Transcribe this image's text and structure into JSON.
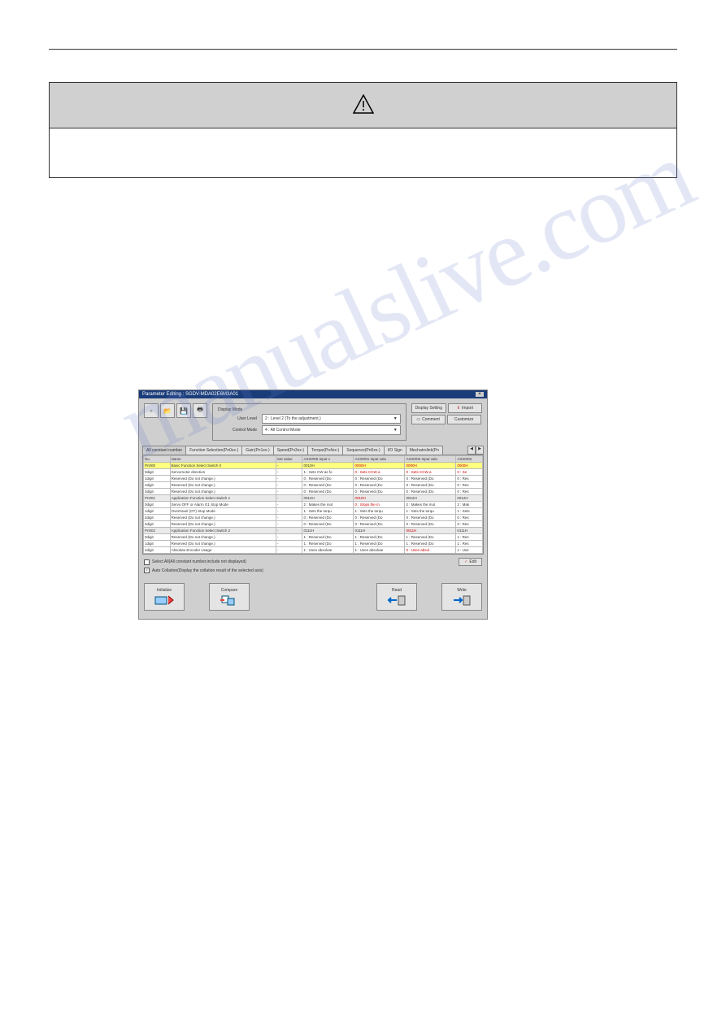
{
  "document": {
    "section_title": "",
    "caution_label": "",
    "caution_text": "",
    "watermark": "manualslive.com"
  },
  "window": {
    "title": "Parameter Editing : SGDV-MDA02E6M3A01",
    "close": "×",
    "display_mode": {
      "group_label": "Display Mode",
      "user_level_label": "User Level",
      "user_level_value": "2 : Level 2 (To the adjustment.)",
      "control_mode_label": "Control Mode",
      "control_mode_value": "4 : All Control Mode"
    },
    "buttons": {
      "display_setting": "Display Setting",
      "import": "Import",
      "comment": "Comment",
      "customize": "Customize",
      "edit": "Edit",
      "initialize": "Initialize",
      "compare": "Compare",
      "read": "Read",
      "write": "Write"
    },
    "tabs": [
      "All constant number",
      "Function Selection(Pn0xx-)",
      "Gain(Pn1xx-)",
      "Speed(Pn3xx-)",
      "Torque(Pn4xx-)",
      "Sequence(Pn5xx-)",
      "I/O Sign",
      "Mechatrolink(Pn"
    ],
    "columns": [
      "No.",
      "Name",
      "Set value",
      "AXIS#00 Input v",
      "AXIS#01 Input valu",
      "AXIS#02 Input valu",
      "AXIS#03"
    ],
    "rows": [
      {
        "no": "Pn000",
        "name": "Basic Function Select Switch 0",
        "set": "-",
        "a0": "0010H",
        "a1": "0000H",
        "a2": "0000H",
        "a3": "0000H",
        "cls": "hl",
        "a1r": true,
        "a2r": true,
        "a3r": true
      },
      {
        "no": "0digit",
        "name": "Servomotor direction",
        "set": "-",
        "a0": "1 : Sets CW as fo",
        "a1": "0 : Sets CCW a",
        "a2": "0 : Sets CCW a",
        "a3": "0 : Se",
        "cls": "wt",
        "a1r": true,
        "a2r": true,
        "a3r": true
      },
      {
        "no": "1digit",
        "name": "Reserved (Do not change.)",
        "set": "-",
        "a0": "0 : Reserved (Do",
        "a1": "0 : Reserved (Do",
        "a2": "0 : Reserved (Do",
        "a3": "0 : Res",
        "cls": "wt"
      },
      {
        "no": "2digit",
        "name": "Reserved (Do not change.)",
        "set": "-",
        "a0": "0 : Reserved (Do",
        "a1": "0 : Reserved (Do",
        "a2": "0 : Reserved (Do",
        "a3": "0 : Res",
        "cls": "wt"
      },
      {
        "no": "3digit",
        "name": "Reserved (Do not change.)",
        "set": "-",
        "a0": "0 : Reserved (Do",
        "a1": "0 : Reserved (Do",
        "a2": "0 : Reserved (Do",
        "a3": "0 : Res",
        "cls": "wt"
      },
      {
        "no": "Pn001",
        "name": "Application Function Select Switch 1",
        "set": "-",
        "a0": "0012H",
        "a1": "0010H",
        "a2": "0012H",
        "a3": "0012H",
        "cls": "gr",
        "a1r": true
      },
      {
        "no": "0digit",
        "name": "Servo OFF or Alarm G1 Stop Mode",
        "set": "-",
        "a0": "2 : Makes the mot",
        "a1": "0 : Stops the m",
        "a2": "2 : Makes the mot",
        "a3": "2 : Mak",
        "cls": "wt",
        "a1r": true
      },
      {
        "no": "1digit",
        "name": "Overtravel (OT) Stop Mode",
        "set": "-",
        "a0": "1 : Sets the torqu",
        "a1": "1 : Sets the torqu",
        "a2": "1 : Sets the torqu",
        "a3": "1 : Sets",
        "cls": "wt"
      },
      {
        "no": "2digit",
        "name": "Reserved (Do not change.)",
        "set": "-",
        "a0": "0 : Reserved (Do",
        "a1": "0 : Reserved (Do",
        "a2": "0 : Reserved (Do",
        "a3": "0 : Res",
        "cls": "wt"
      },
      {
        "no": "3digit",
        "name": "Reserved (Do not change.)",
        "set": "-",
        "a0": "0 : Reserved (Do",
        "a1": "0 : Reserved (Do",
        "a2": "0 : Reserved (Do",
        "a3": "0 : Res",
        "cls": "wt"
      },
      {
        "no": "Pn002",
        "name": "Application Function Select Switch 2",
        "set": "-",
        "a0": "0111H",
        "a1": "0111H",
        "a2": "0011H",
        "a3": "0111H",
        "cls": "gr",
        "a2r": true
      },
      {
        "no": "0digit",
        "name": "Reserved (Do not change.)",
        "set": "-",
        "a0": "1 : Reserved (Do",
        "a1": "1 : Reserved (Do",
        "a2": "1 : Reserved (Do",
        "a3": "1 : Res",
        "cls": "wt"
      },
      {
        "no": "1digit",
        "name": "Reserved (Do not change.)",
        "set": "-",
        "a0": "1 : Reserved (Do",
        "a1": "1 : Reserved (Do",
        "a2": "1 : Reserved (Do",
        "a3": "1 : Res",
        "cls": "wt"
      },
      {
        "no": "2digit",
        "name": "Absolute Encoder Usage",
        "set": "-",
        "a0": "1 : Uses absolute",
        "a1": "1 : Uses absolute",
        "a2": "0 : Uses absol",
        "a3": "1 : Use",
        "cls": "wt",
        "a2r": true
      }
    ],
    "checks": {
      "select_all": "Select All(All constant number,include not displayed)",
      "auto_collation": "Auto Collation(Display the collation result of the selected axis)"
    }
  }
}
